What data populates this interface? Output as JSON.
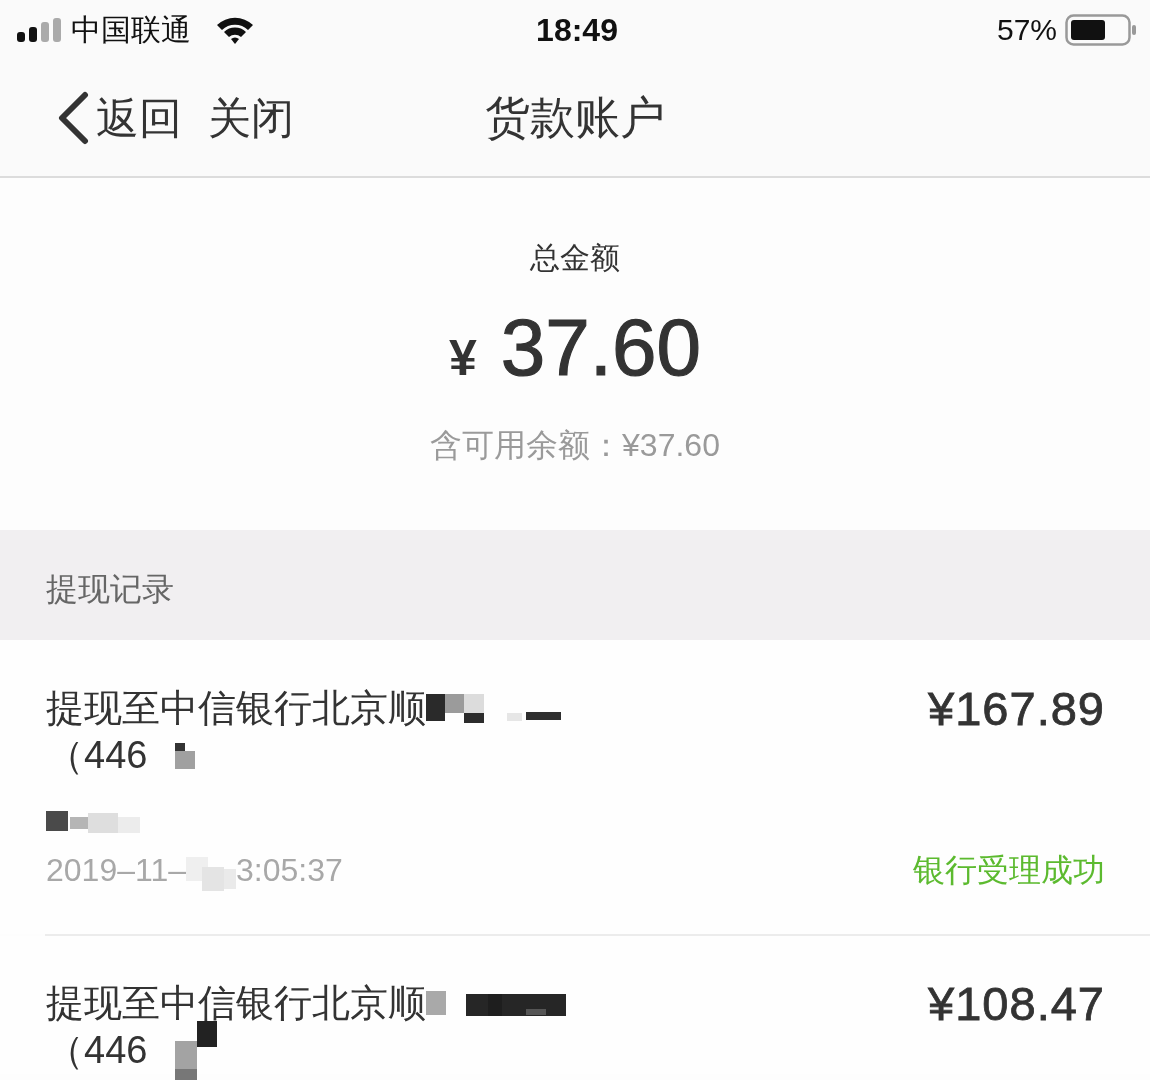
{
  "status_bar": {
    "carrier": "中国联通",
    "time": "18:49",
    "battery": "57%"
  },
  "nav": {
    "back": "返回",
    "close": "关闭",
    "title": "货款账户"
  },
  "summary": {
    "label": "总金额",
    "currency": "¥",
    "amount": "37.60",
    "available": "含可用余额：¥37.60"
  },
  "section": {
    "title": "提现记录"
  },
  "records": [
    {
      "title": "提现至中信银行北京顺",
      "account": "（446",
      "masked": true,
      "amount": "¥167.89",
      "date_parts": [
        "2019–11–",
        "3:05:37"
      ],
      "status": {
        "label": "银行受理成功",
        "kind": "success"
      }
    },
    {
      "title": "提现至中信银行北京顺",
      "account": "（446",
      "masked": true,
      "amount": "¥108.47"
    }
  ]
}
